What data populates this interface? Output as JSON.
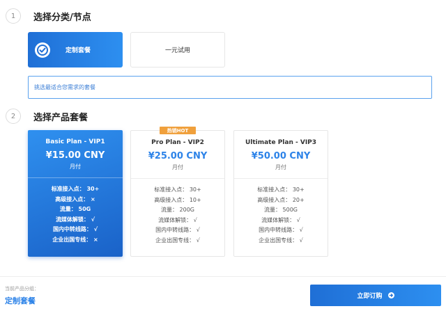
{
  "step1": {
    "number": "1",
    "title": "选择分类/节点"
  },
  "categories": [
    {
      "label": "定制套餐",
      "selected": true
    },
    {
      "label": "一元试用",
      "selected": false
    }
  ],
  "category_description": "挑选最适合您需求的套餐",
  "step2": {
    "number": "2",
    "title": "选择产品套餐"
  },
  "hot_badge": "热销HOT",
  "plans": [
    {
      "name": "Basic Plan - VIP1",
      "price": "¥15.00 CNY",
      "cycle": "月付",
      "selected": true,
      "features": [
        "标准接入点： 30+",
        "高级接入点： ×",
        "流量： 50G",
        "流媒体解锁： √",
        "国内中转线路： √",
        "企业出国专线： ×"
      ]
    },
    {
      "name": "Pro Plan - VIP2",
      "price": "¥25.00 CNY",
      "cycle": "月付",
      "selected": false,
      "features": [
        "标准接入点： 30+",
        "高级接入点： 10+",
        "流量： 200G",
        "流媒体解锁： √",
        "国内中转线路： √",
        "企业出国专线： √"
      ]
    },
    {
      "name": "Ultimate Plan - VIP3",
      "price": "¥50.00 CNY",
      "cycle": "月付",
      "selected": false,
      "features": [
        "标准接入点： 30+",
        "高级接入点： 20+",
        "流量： 500G",
        "流媒体解锁： √",
        "国内中转线路： √",
        "企业出国专线： √"
      ]
    }
  ],
  "footer": {
    "current_group_label": "当前产品分组：",
    "current_group_value": "定制套餐",
    "order_button": "立即订购"
  },
  "colors": {
    "accent": "#2d83e8",
    "hot": "#f0a03c"
  },
  "icons": {
    "selected_category": "check-circle-icon",
    "order_button": "arrow-right-circle-icon"
  }
}
